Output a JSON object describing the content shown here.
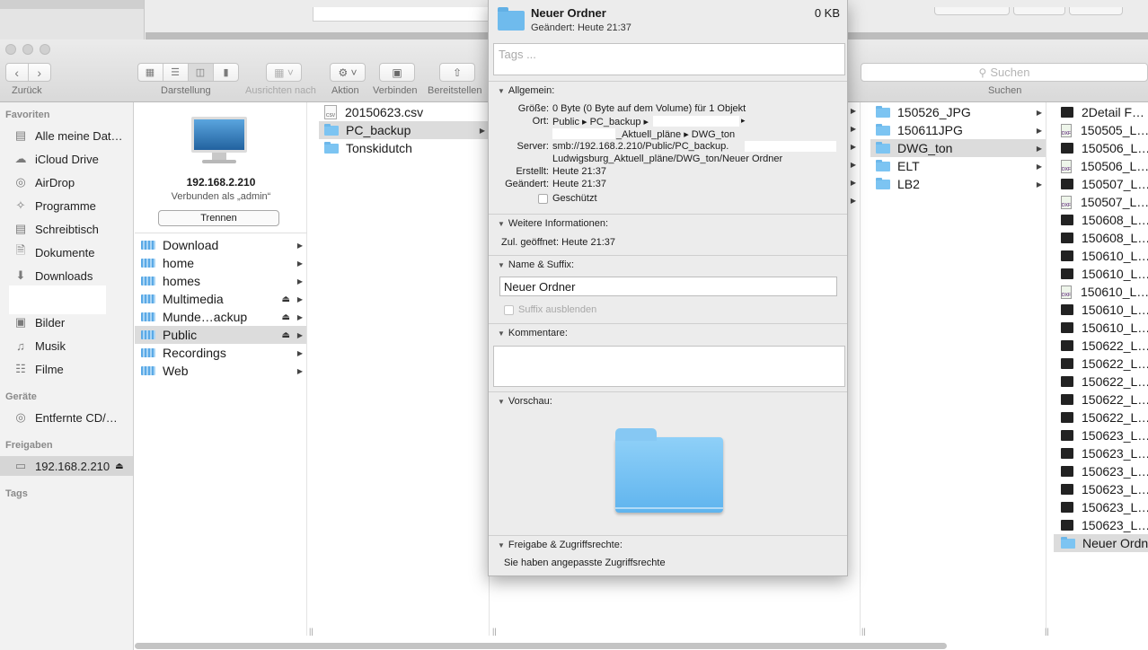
{
  "toolbar": {
    "back_label": "Zurück",
    "view_label": "Darstellung",
    "arrange_label": "Ausrichten nach",
    "action_label": "Aktion",
    "connect_label": "Verbinden",
    "share_label": "Bereitstellen",
    "search_placeholder": "Suchen",
    "search_label": "Suchen"
  },
  "sidebar": {
    "favorites_header": "Favoriten",
    "favorites": [
      {
        "label": "Alle meine Dat…",
        "icon": "all-files-icon"
      },
      {
        "label": "iCloud Drive",
        "icon": "cloud-icon"
      },
      {
        "label": "AirDrop",
        "icon": "airdrop-icon"
      },
      {
        "label": "Programme",
        "icon": "applications-icon"
      },
      {
        "label": "Schreibtisch",
        "icon": "desktop-icon"
      },
      {
        "label": "Dokumente",
        "icon": "documents-icon"
      },
      {
        "label": "Downloads",
        "icon": "downloads-icon"
      },
      {
        "label": "Bilder",
        "icon": "camera-icon"
      },
      {
        "label": "Musik",
        "icon": "music-icon"
      },
      {
        "label": "Filme",
        "icon": "film-icon"
      }
    ],
    "devices_header": "Geräte",
    "devices": [
      {
        "label": "Entfernte CD/…",
        "icon": "disc-icon"
      }
    ],
    "shared_header": "Freigaben",
    "shared": [
      {
        "label": "192.168.2.210",
        "icon": "display-icon"
      }
    ],
    "tags_header": "Tags"
  },
  "server": {
    "name": "192.168.2.210",
    "connected_as": "Verbunden als „admin“",
    "disconnect_label": "Trennen",
    "shares": [
      {
        "label": "Download",
        "eject": false
      },
      {
        "label": "home",
        "eject": false
      },
      {
        "label": "homes",
        "eject": false
      },
      {
        "label": "Multimedia",
        "eject": true
      },
      {
        "label": "Munde…ackup",
        "eject": true
      },
      {
        "label": "Public",
        "eject": true,
        "selected": true
      },
      {
        "label": "Recordings",
        "eject": false
      },
      {
        "label": "Web",
        "eject": false
      }
    ]
  },
  "column_public": [
    {
      "label": "20150623.csv",
      "type": "file"
    },
    {
      "label": "PC_backup",
      "type": "folder",
      "selected": true
    },
    {
      "label": "Tonskidutch",
      "type": "folder"
    }
  ],
  "column_aktuell": [
    {
      "label": "150526_JPG"
    },
    {
      "label": "150611JPG"
    },
    {
      "label": "DWG_ton",
      "selected": true
    },
    {
      "label": "ELT"
    },
    {
      "label": "LB2"
    }
  ],
  "column_dwg": [
    {
      "label": "2Detail F…",
      "type": "dwg"
    },
    {
      "label": "150505_L…",
      "type": "dxf"
    },
    {
      "label": "150506_L…",
      "type": "dwg"
    },
    {
      "label": "150506_L…",
      "type": "dxf"
    },
    {
      "label": "150507_L…",
      "type": "dwg"
    },
    {
      "label": "150507_L…",
      "type": "dxf"
    },
    {
      "label": "150608_L…",
      "type": "dwg"
    },
    {
      "label": "150608_L…",
      "type": "dwg"
    },
    {
      "label": "150610_L…",
      "type": "dwg"
    },
    {
      "label": "150610_L…",
      "type": "dwg"
    },
    {
      "label": "150610_L…",
      "type": "dxf"
    },
    {
      "label": "150610_L…",
      "type": "dwg"
    },
    {
      "label": "150610_L…",
      "type": "dwg"
    },
    {
      "label": "150622_L…",
      "type": "dwg"
    },
    {
      "label": "150622_L…",
      "type": "dwg"
    },
    {
      "label": "150622_L…",
      "type": "dwg"
    },
    {
      "label": "150622_L…",
      "type": "dwg"
    },
    {
      "label": "150622_L…",
      "type": "dwg"
    },
    {
      "label": "150623_L…",
      "type": "dwg"
    },
    {
      "label": "150623_L…",
      "type": "dwg"
    },
    {
      "label": "150623_L…",
      "type": "dwg"
    },
    {
      "label": "150623_L…",
      "type": "dwg"
    },
    {
      "label": "150623_L…",
      "type": "dwg"
    },
    {
      "label": "150623_L…",
      "type": "dwg"
    },
    {
      "label": "Neuer Ordn",
      "type": "folder",
      "selected": true
    }
  ],
  "info": {
    "name": "Neuer Ordner",
    "size": "0 KB",
    "modified_line": "Geändert: Heute 21:37",
    "tags_placeholder": "Tags ...",
    "general_title": "Allgemein:",
    "size_key": "Größe:",
    "size_val": "0 Byte (0 Byte auf dem Volume) für 1 Objekt",
    "where_key": "Ort:",
    "where_val1": "Public ▸ PC_backup ▸",
    "where_val1b": "▸",
    "where_val2": "_Aktuell_pläne ▸ DWG_ton",
    "server_key": "Server:",
    "server_val1": "smb://192.168.2.210/Public/PC_backup.",
    "server_val2": "Ludwigsburg_Aktuell_pläne/DWG_ton/Neuer Ordner",
    "created_key": "Erstellt:",
    "created_val": "Heute 21:37",
    "modified_key": "Geändert:",
    "modified_val": "Heute 21:37",
    "locked_label": "Geschützt",
    "more_title": "Weitere Informationen:",
    "last_opened": "Zul. geöffnet: Heute 21:37",
    "name_title": "Name & Suffix:",
    "name_value": "Neuer Ordner",
    "hide_ext_label": "Suffix ausblenden",
    "comments_title": "Kommentare:",
    "preview_title": "Vorschau:",
    "sharing_title": "Freigabe & Zugriffsrechte:",
    "sharing_text": "Sie haben angepasste Zugriffsrechte"
  }
}
